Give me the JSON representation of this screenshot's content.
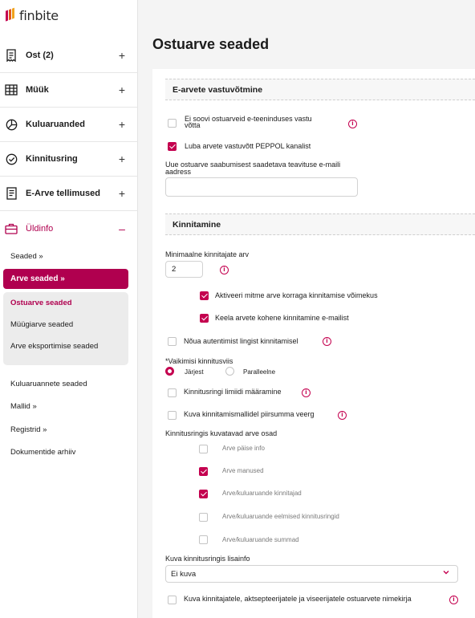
{
  "brand": {
    "name": "finbite",
    "accent": "#c4004f",
    "accent_dark": "#b0004f"
  },
  "sidebar": {
    "nav": [
      {
        "label": "Ost (2)",
        "sign": "+"
      },
      {
        "label": "Müük",
        "sign": "+"
      },
      {
        "label": "Kuluaruanded",
        "sign": "+"
      },
      {
        "label": "Kinnitusring",
        "sign": "+"
      },
      {
        "label": "E-Arve tellimused",
        "sign": "+"
      },
      {
        "label": "Üldinfo",
        "sign": "–"
      }
    ],
    "sub": {
      "seaded": "Seaded »",
      "arve_seaded": "Arve seaded »",
      "panel": [
        "Ostuarve seaded",
        "Müügiarve seaded",
        "Arve eksportimise seaded"
      ],
      "kuluaruannete": "Kuluaruannete seaded",
      "mallid": "Mallid »",
      "registrid": "Registrid »",
      "dokumentide": "Dokumentide arhiiv"
    }
  },
  "page": {
    "title": "Ostuarve seaded",
    "section_evastuvotmine": "E-arvete vastuvõtmine",
    "ei_soovi_line1": "Ei soovi ostuarveid e-teeninduses vastu",
    "ei_soovi_line2": "võtta",
    "luba_peppol": "Luba arvete vastuvõtt PEPPOL kanalist",
    "email_label_line1": "Uue ostuarve saabumisest saadetava teavituse e-maili",
    "email_label_line2": "aadress",
    "email_value": "",
    "section_kinnitamine": "Kinnitamine",
    "min_kinnitajate": "Minimaalne kinnitajate arv",
    "min_kinnitajate_value": "2",
    "aktiveeri_mitme": "Aktiveeri mitme arve korraga kinnitamise võimekus",
    "keela_email": "Keela arvete kohene kinnitamine e-mailist",
    "noua_autentimist": "Nõua autentimist lingist kinnitamisel",
    "vaikimisi_label": "*Vaikimisi kinnitusviis",
    "radio_jarjest": "Järjest",
    "radio_paralleelne": "Paralleelne",
    "limiidi": "Kinnitusringi limiidi määramine",
    "piirsumma": "Kuva kinnitamismallidel piirsumma veerg",
    "osad_label": "Kinnitusringis kuvatavad arve osad",
    "osad": [
      {
        "label": "Arve päise info",
        "checked": false
      },
      {
        "label": "Arve manused",
        "checked": true
      },
      {
        "label": "Arve/kuluaruande kinnitajad",
        "checked": true
      },
      {
        "label": "Arve/kuluaruande eelmised kinnitusringid",
        "checked": false
      },
      {
        "label": "Arve/kuluaruande summad",
        "checked": false
      }
    ],
    "lisainfo_label": "Kuva kinnitusringis lisainfo",
    "lisainfo_value": "Ei kuva",
    "nimekirja": "Kuva kinnitajatele, aktsepteerijatele ja viseerijatele ostuarvete nimekirja"
  }
}
